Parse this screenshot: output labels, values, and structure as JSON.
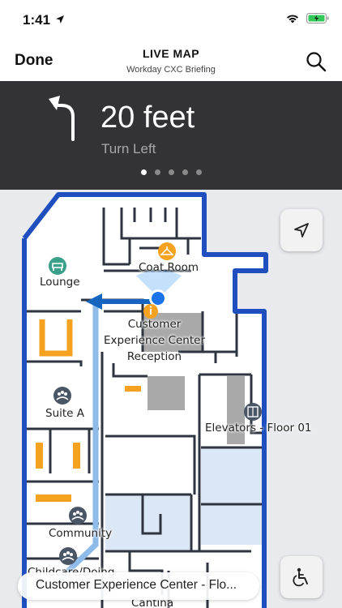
{
  "status": {
    "time": "1:41"
  },
  "nav": {
    "done_label": "Done",
    "title": "LIVE MAP",
    "subtitle": "Workday CXC Briefing"
  },
  "direction": {
    "distance": "20 feet",
    "instruction": "Turn Left",
    "page_count": 5,
    "active_page": 1
  },
  "map": {
    "labels": {
      "coat_room": "Coat Room",
      "lounge": "Lounge",
      "reception": "Customer\nExperience Center\nReception",
      "suite_a": "Suite A",
      "elevators": "Elevators - Floor 01",
      "community": "Community",
      "childcare": "Childcare/Doing",
      "cantina": "Cantina"
    },
    "floor_selector": "Customer Experience Center - Flo..."
  },
  "colors": {
    "wall_blue": "#1f4fbf",
    "route_blue": "#1565c0",
    "amenity_orange": "#f4a21f",
    "current_location": "#1a73e8"
  },
  "icons": [
    "location-arrow-icon",
    "wifi-icon",
    "battery-icon",
    "search-icon",
    "turn-left-icon",
    "recenter-icon",
    "accessibility-icon",
    "lounge-chair-icon",
    "coat-hanger-icon",
    "info-icon",
    "people-icon",
    "elevator-icon"
  ]
}
